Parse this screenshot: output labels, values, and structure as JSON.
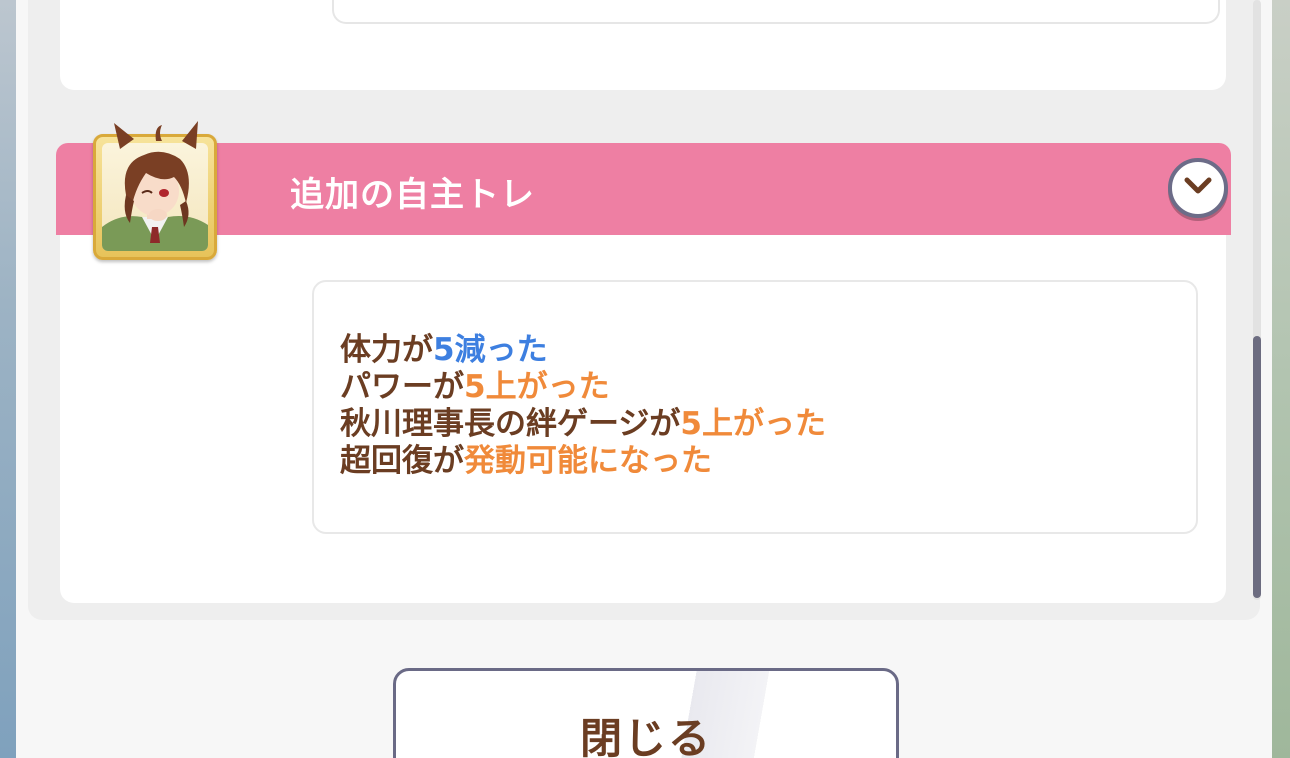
{
  "event": {
    "title": "追加の自主トレ",
    "character_icon": "character-portrait-icon",
    "expand_icon": "chevron-down-icon"
  },
  "results": [
    {
      "prefix": "体力が",
      "value": "5減った",
      "value_color": "#3d7fe0"
    },
    {
      "prefix": "パワーが",
      "value": "5上がった",
      "value_color": "#f08a3a"
    },
    {
      "prefix": "秋川理事長の絆ゲージが",
      "value": "5上がった",
      "value_color": "#f08a3a"
    },
    {
      "prefix": "超回復が",
      "value": "発動可能になった",
      "value_color": "#f08a3a"
    }
  ],
  "buttons": {
    "close_label": "閉じる"
  },
  "colors": {
    "header": "#ee7fa3",
    "text_brown": "#6b3d22",
    "decrease_blue": "#3d7fe0",
    "increase_orange": "#f08a3a"
  },
  "scroll": {
    "position": 0.85
  }
}
